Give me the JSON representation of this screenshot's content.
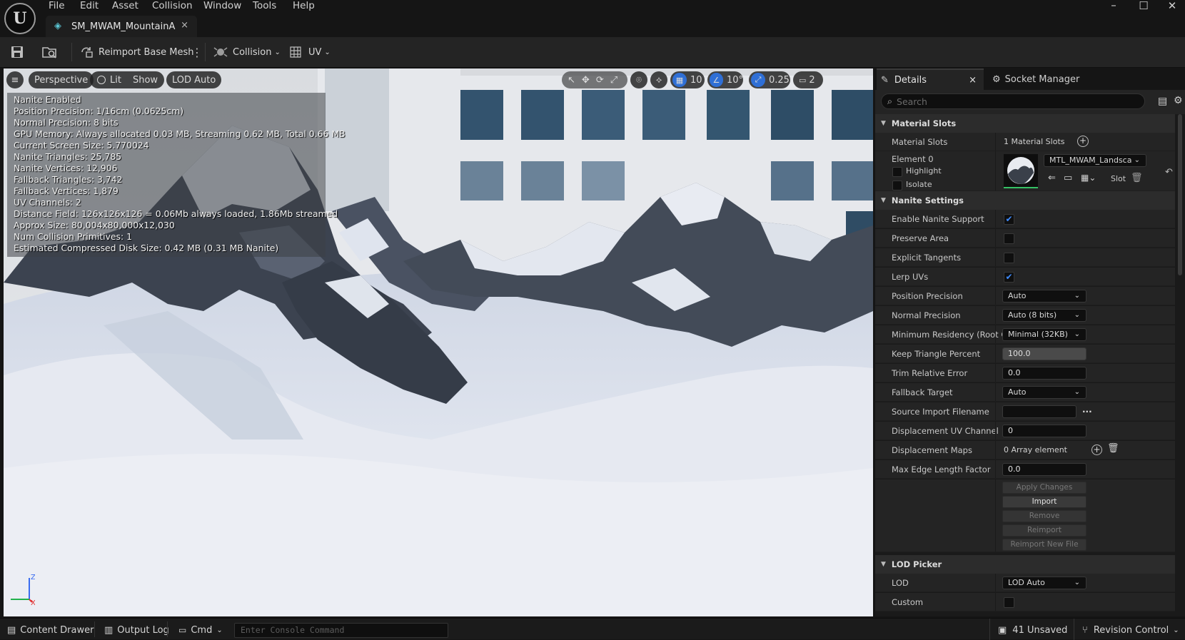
{
  "menu": {
    "items": [
      "File",
      "Edit",
      "Asset",
      "Collision",
      "Window",
      "Tools",
      "Help"
    ]
  },
  "document_tab": {
    "label": "SM_MWAM_MountainA",
    "close": "×"
  },
  "window_controls": {
    "minimize": "–",
    "maximize": "☐",
    "close": "✕"
  },
  "toolbar": {
    "reimport_label": "Reimport Base Mesh",
    "collision_label": "Collision",
    "uv_label": "UV"
  },
  "viewport": {
    "menu_icon": "≡",
    "perspective": "Perspective",
    "lit": "Lit",
    "show": "Show",
    "lod": "LOD Auto",
    "grid_snap": "10",
    "rotation_snap": "10°",
    "scale_snap": "0.25",
    "camera_speed": "2",
    "stats": [
      "Nanite Enabled",
      "Position Precision: 1/16cm (0.0625cm)",
      "Normal Precision: 8 bits",
      "GPU Memory: Always allocated 0.03 MB, Streaming 0.62 MB, Total 0.66 MB",
      "Current Screen Size:  5.770024",
      "Nanite Triangles:  25,785",
      "Nanite Vertices:  12,906",
      "Fallback Triangles:  3,742",
      "Fallback Vertices:  1,879",
      "UV Channels:  2",
      "Distance Field:  126x126x126 = 0.06Mb always loaded, 1.86Mb streamed",
      "Approx Size: 80,004x80,000x12,030",
      "Num Collision Primitives:  1",
      "Estimated Compressed Disk Size: 0.42 MB (0.31 MB Nanite)"
    ],
    "axis": {
      "z": "Z",
      "x": "X"
    }
  },
  "details": {
    "tab_details": "Details",
    "tab_close": "×",
    "tab_socket": "Socket Manager",
    "search_placeholder": "Search",
    "material_slots": {
      "header": "Material Slots",
      "row_label": "Material Slots",
      "row_value": "1 Material Slots",
      "element_label": "Element 0",
      "highlight": "Highlight",
      "isolate": "Isolate",
      "material_name": "MTL_MWAM_Landscape",
      "slot_label": "Slot"
    },
    "nanite": {
      "header": "Nanite Settings",
      "enable_support": {
        "label": "Enable Nanite Support",
        "checked": true
      },
      "preserve_area": {
        "label": "Preserve Area",
        "checked": false
      },
      "explicit_tangents": {
        "label": "Explicit Tangents",
        "checked": false
      },
      "lerp_uvs": {
        "label": "Lerp UVs",
        "checked": true
      },
      "position_precision": {
        "label": "Position Precision",
        "value": "Auto"
      },
      "normal_precision": {
        "label": "Normal Precision",
        "value": "Auto (8 bits)"
      },
      "min_residency": {
        "label": "Minimum Residency (Root Ge",
        "value": "Minimal (32KB)"
      },
      "keep_triangle": {
        "label": "Keep Triangle Percent",
        "value": "100.0",
        "fraction": 1.0
      },
      "trim_error": {
        "label": "Trim Relative Error",
        "value": "0.0"
      },
      "fallback_target": {
        "label": "Fallback Target",
        "value": "Auto"
      },
      "source_import": {
        "label": "Source Import Filename",
        "value": "",
        "browse": "..."
      },
      "displacement_uv": {
        "label": "Displacement UV Channel",
        "value": "0"
      },
      "displacement_maps": {
        "label": "Displacement Maps",
        "value": "0 Array element"
      },
      "max_edge": {
        "label": "Max Edge Length Factor",
        "value": "0.0"
      },
      "buttons": {
        "apply": "Apply Changes",
        "import": "Import",
        "remove": "Remove",
        "reimport": "Reimport",
        "reimport_new": "Reimport New File"
      }
    },
    "lod_picker": {
      "header": "LOD Picker",
      "lod": {
        "label": "LOD",
        "value": "LOD Auto"
      },
      "custom": {
        "label": "Custom",
        "checked": false
      }
    }
  },
  "statusbar": {
    "content_drawer": "Content Drawer",
    "output_log": "Output Log",
    "cmd": "Cmd",
    "console_placeholder": "Enter Console Command",
    "unsaved": "41 Unsaved",
    "revision_control": "Revision Control"
  },
  "colors": {
    "accent_blue": "#3d8bff",
    "panel_bg": "#242424",
    "header_bg": "#2c2c2c"
  }
}
